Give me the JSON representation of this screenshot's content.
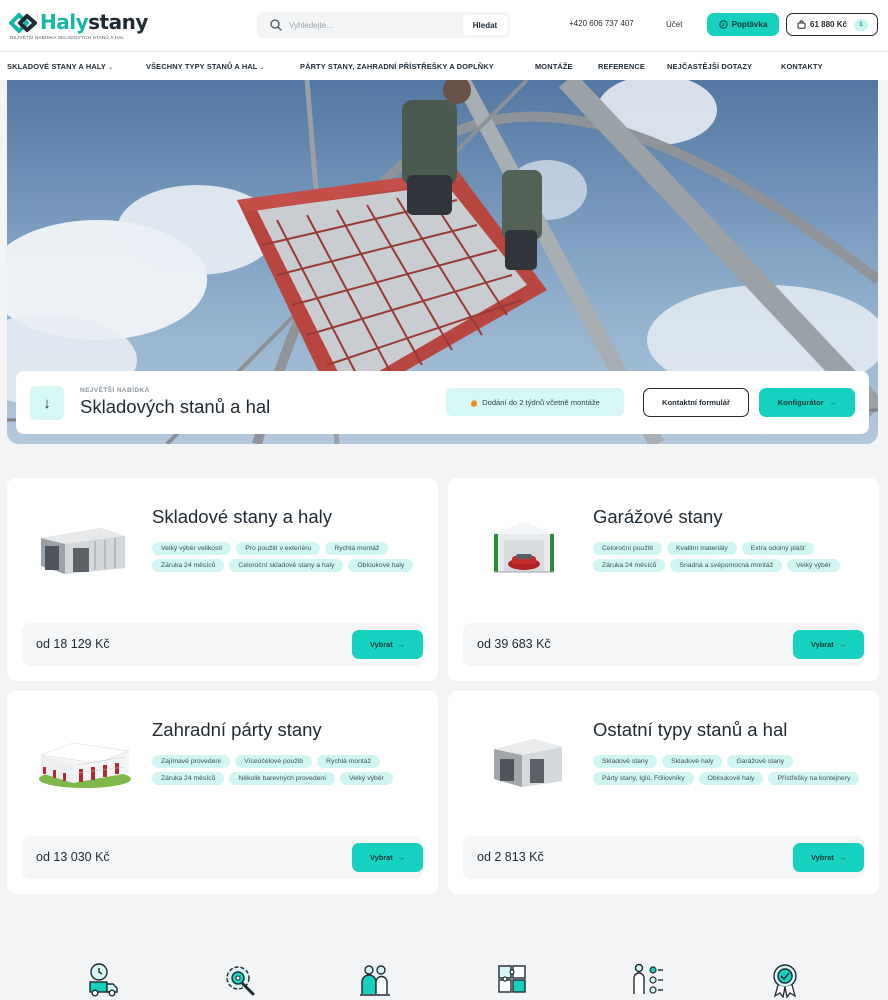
{
  "brand": {
    "name_part1": "Haly",
    "name_part2": "stany",
    "tagline": "NEJVĚTŠÍ NABÍDKA SKLADOVÝCH STANŮ A HAL",
    "accent": "#16d1bf"
  },
  "header": {
    "search_placeholder": "Vyhledejte...",
    "search_button": "Hledat",
    "phone": "+420 606 737 407",
    "account": "Účet",
    "inquiry": "Poptávka",
    "cart_total": "61 880 Kč",
    "cart_count": "1"
  },
  "nav": {
    "items": [
      "SKLADOVÉ STANY A HALY",
      "VŠECHNY TYPY STANŮ A HAL",
      "PÁRTY STANY, ZAHRADNÍ PŘÍSTŘEŠKY A DOPLŇKY",
      "MONTÁŽE",
      "REFERENCE",
      "NEJČASTĚJŠÍ DOTAZY",
      "KONTAKTY"
    ]
  },
  "hero": {
    "eyebrow": "NEJVĚTŠÍ NABÍDKA",
    "title": "Skladových stanů a hal",
    "badge": "Dodání do 2 týdnů včetně montáže",
    "contact_button": "Kontaktní formulář",
    "config_button": "Konfigurátor"
  },
  "cards": [
    {
      "title": "Skladové stany a haly",
      "tags": [
        "Velký výběr velikostí",
        "Pro použití v exteriéru",
        "Rychlá montáž",
        "Záruka 24 měsíců",
        "Celoroční skladové stany a haly",
        "Obloukové haly"
      ],
      "price": "od 18 129 Kč",
      "button": "Vybrat"
    },
    {
      "title": "Garážové stany",
      "tags": [
        "Celoroční použití",
        "Kvalitní materiály",
        "Extra odolný plášť",
        "Záruka 24 měsíců",
        "Snadná a svépomocná montáž",
        "Velký výběr"
      ],
      "price": "od 39 683 Kč",
      "button": "Vybrat"
    },
    {
      "title": "Zahradní párty stany",
      "tags": [
        "Zajímavé provedení",
        "Víceúčelové použití",
        "Rychlá montáž",
        "Záruka 24 měsíců",
        "Několik barevných provedení",
        "Velký výběr"
      ],
      "price": "od 13 030 Kč",
      "button": "Vybrat"
    },
    {
      "title": "Ostatní typy stanů a hal",
      "tags": [
        "Skladové stany",
        "Skladové haly",
        "Garážové stany",
        "Párty stany, Iglú, Fóliovníky",
        "Obloukové haly",
        "Přístřešky na kontejnery"
      ],
      "price": "od 2 813 Kč",
      "button": "Vybrat"
    }
  ],
  "features": {
    "icons": [
      "delivery-clock-icon",
      "settings-gear-icon",
      "team-icon",
      "puzzle-icon",
      "checklist-person-icon",
      "quality-badge-icon"
    ]
  }
}
